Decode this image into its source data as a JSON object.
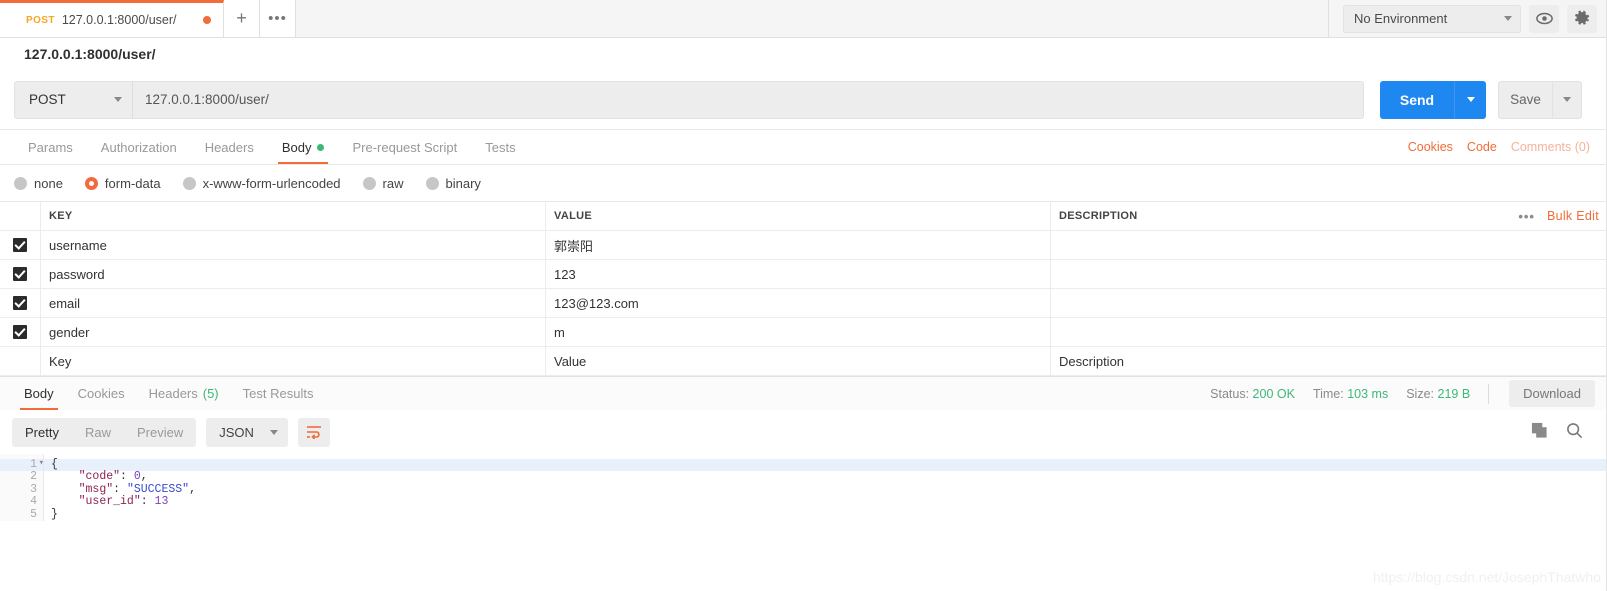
{
  "tabbar": {
    "request_tab": {
      "method": "POST",
      "url": "127.0.0.1:8000/user/"
    },
    "new_tab_label": "+",
    "more_tab_label": "•••",
    "environment": {
      "selected": "No Environment"
    },
    "eye_icon": "eye-icon",
    "gear_icon": "gear-icon"
  },
  "request": {
    "name": "127.0.0.1:8000/user/",
    "method": "POST",
    "url": "127.0.0.1:8000/user/",
    "send_label": "Send",
    "save_label": "Save",
    "tabs": [
      {
        "label": "Params",
        "active": false
      },
      {
        "label": "Authorization",
        "active": false
      },
      {
        "label": "Headers",
        "active": false
      },
      {
        "label": "Body",
        "active": true
      },
      {
        "label": "Pre-request Script",
        "active": false
      },
      {
        "label": "Tests",
        "active": false
      }
    ],
    "links": {
      "cookies": "Cookies",
      "code": "Code",
      "comments": "Comments (0)"
    },
    "body_types": [
      {
        "label": "none",
        "checked": false
      },
      {
        "label": "form-data",
        "checked": true
      },
      {
        "label": "x-www-form-urlencoded",
        "checked": false
      },
      {
        "label": "raw",
        "checked": false
      },
      {
        "label": "binary",
        "checked": false
      }
    ],
    "table": {
      "headers": {
        "key": "KEY",
        "value": "VALUE",
        "description": "DESCRIPTION"
      },
      "bulk_edit_label": "Bulk Edit",
      "more_label": "•••",
      "rows": [
        {
          "checked": true,
          "key": "username",
          "value": "郭崇阳",
          "description": ""
        },
        {
          "checked": true,
          "key": "password",
          "value": "123",
          "description": ""
        },
        {
          "checked": true,
          "key": "email",
          "value": "123@123.com",
          "description": ""
        },
        {
          "checked": true,
          "key": "gender",
          "value": "m",
          "description": ""
        }
      ],
      "empty_row": {
        "key": "Key",
        "value": "Value",
        "description": "Description"
      }
    }
  },
  "response": {
    "tabs": [
      {
        "label": "Body",
        "active": true,
        "count": ""
      },
      {
        "label": "Cookies",
        "active": false,
        "count": ""
      },
      {
        "label": "Headers",
        "active": false,
        "count": "(5)"
      },
      {
        "label": "Test Results",
        "active": false,
        "count": ""
      }
    ],
    "meta": {
      "status_label": "Status:",
      "status_value": "200 OK",
      "time_label": "Time:",
      "time_value": "103 ms",
      "size_label": "Size:",
      "size_value": "219 B"
    },
    "download_label": "Download",
    "view_modes": [
      {
        "label": "Pretty",
        "active": true
      },
      {
        "label": "Raw",
        "active": false
      },
      {
        "label": "Preview",
        "active": false
      }
    ],
    "format": "JSON",
    "wrap_icon": "word-wrap-icon",
    "copy_icon": "copy-icon",
    "search_icon": "search-icon",
    "body": {
      "line_numbers": [
        "1",
        "2",
        "3",
        "4",
        "5"
      ],
      "lines": [
        {
          "text": "{",
          "tokens": [
            {
              "t": "{",
              "c": "pun"
            }
          ]
        },
        {
          "text": "    \"code\": 0,",
          "tokens": [
            {
              "t": "    ",
              "c": "pun"
            },
            {
              "t": "\"code\"",
              "c": "key"
            },
            {
              "t": ": ",
              "c": "pun"
            },
            {
              "t": "0",
              "c": "num"
            },
            {
              "t": ",",
              "c": "pun"
            }
          ]
        },
        {
          "text": "    \"msg\": \"SUCCESS\",",
          "tokens": [
            {
              "t": "    ",
              "c": "pun"
            },
            {
              "t": "\"msg\"",
              "c": "key"
            },
            {
              "t": ": ",
              "c": "pun"
            },
            {
              "t": "\"SUCCESS\"",
              "c": "str"
            },
            {
              "t": ",",
              "c": "pun"
            }
          ]
        },
        {
          "text": "    \"user_id\": 13",
          "tokens": [
            {
              "t": "    ",
              "c": "pun"
            },
            {
              "t": "\"user_id\"",
              "c": "key"
            },
            {
              "t": ": ",
              "c": "pun"
            },
            {
              "t": "13",
              "c": "num"
            }
          ]
        },
        {
          "text": "}",
          "tokens": [
            {
              "t": "}",
              "c": "pun"
            }
          ]
        }
      ],
      "json": {
        "code": 0,
        "msg": "SUCCESS",
        "user_id": 13
      }
    }
  },
  "watermark": "https://blog.csdn.net/JosephThatwho",
  "colors": {
    "accent_orange": "#f26b3a",
    "send_blue": "#1e87f0",
    "success_green": "#3cb878",
    "method_amber": "#f5a623"
  }
}
